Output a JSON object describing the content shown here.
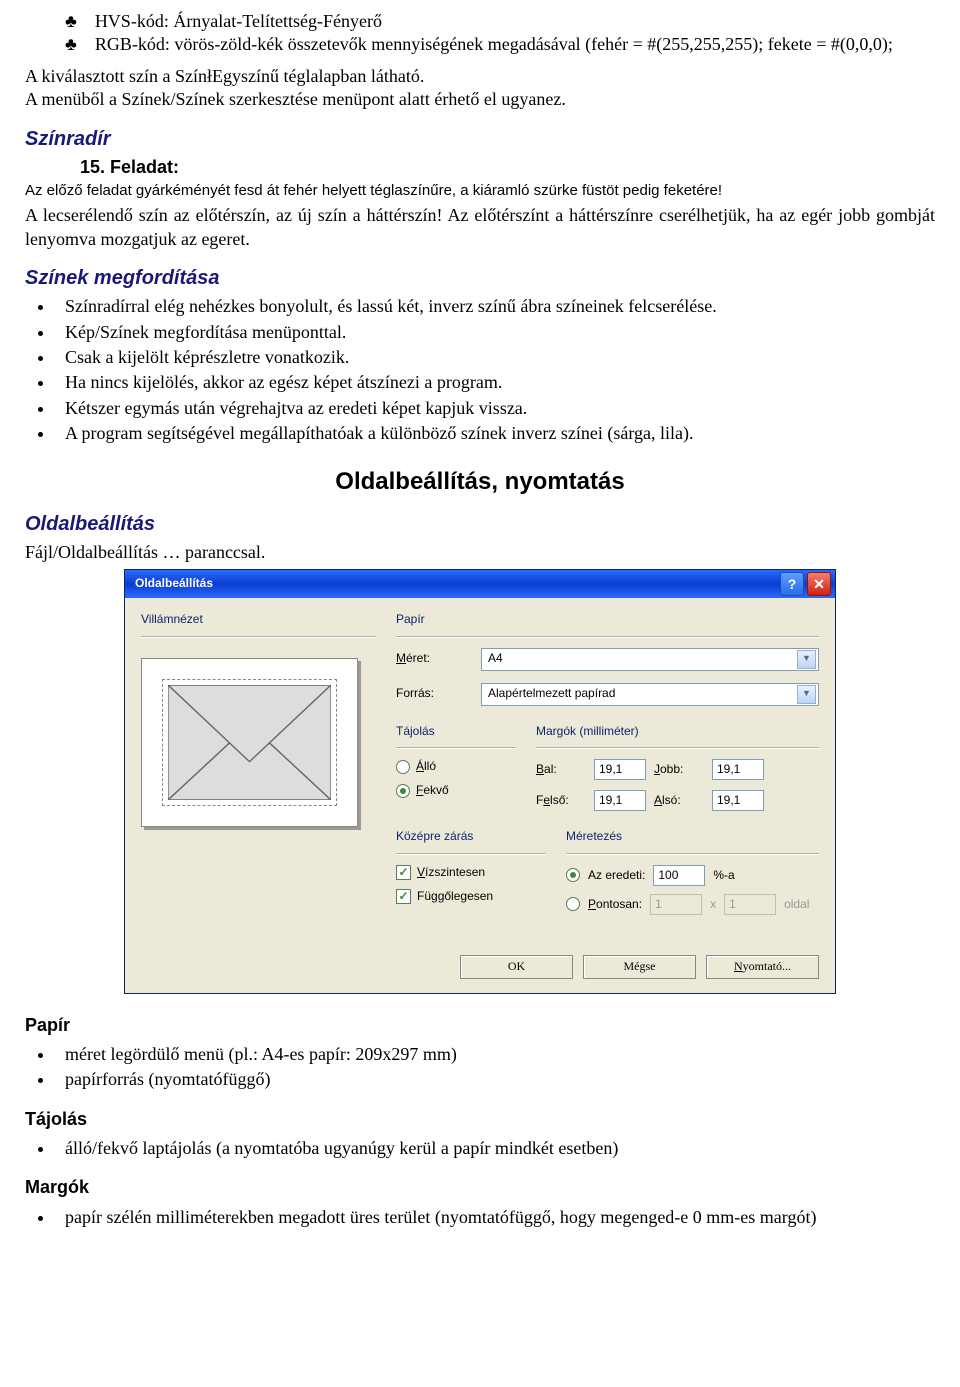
{
  "intro": {
    "hvs": "HVS-kód: Árnyalat-Telítettség-Fényerő",
    "rgb": "RGB-kód: vörös-zöld-kék összetevők mennyiségének megadásával (fehér = #(255,255,255); fekete = #(0,0,0);",
    "chosen": "A kiválasztott szín a SzínłEgyszínű téglalapban látható.",
    "menu": "A menüből a Színek/Színek szerkesztése menüpont alatt érhető el ugyanez."
  },
  "eraser": {
    "title": "Színradír",
    "tasknum": "15. Feladat:",
    "taskbody": "Az előző feladat gyárkéményét fesd át fehér helyett téglaszínűre, a kiáramló szürke füstöt pedig feketére!",
    "note": "A lecserélendő szín az előtérszín, az új szín a háttérszín! Az előtérszínt a háttérszínre cserélhetjük, ha az egér jobb gombját lenyomva mozgatjuk az egeret."
  },
  "invert": {
    "title": "Színek megfordítása",
    "items": [
      "Színradírral elég nehézkes bonyolult, és lassú két, inverz színű ábra színeinek felcserélése.",
      "Kép/Színek megfordítása menüponttal.",
      "Csak a kijelölt képrészletre vonatkozik.",
      "Ha nincs kijelölés, akkor az egész képet átszínezi a program.",
      "Kétszer egymás után végrehajtva az eredeti képet kapjuk vissza.",
      "A program segítségével megállapíthatóak a különböző színek inverz színei (sárga, lila)."
    ]
  },
  "page_setup_heading": "Oldalbeállítás, nyomtatás",
  "setup": {
    "title": "Oldalbeállítás",
    "cmd": "Fájl/Oldalbeállítás … paranccsal."
  },
  "dialog": {
    "title": "Oldalbeállítás",
    "preview_label": "Villámnézet",
    "paper": {
      "label": "Papír",
      "size_label": "Méret:",
      "size_value": "A4",
      "source_label": "Forrás:",
      "source_value": "Alapértelmezett papírad"
    },
    "orientation": {
      "label": "Tájolás",
      "portrait": "Álló",
      "landscape": "Fekvő"
    },
    "margins": {
      "label": "Margók (milliméter)",
      "left_label": "Bal:",
      "left": "19,1",
      "right_label": "Jobb:",
      "right": "19,1",
      "top_label": "Felső:",
      "top": "19,1",
      "bottom_label": "Alsó:",
      "bottom": "19,1"
    },
    "center": {
      "label": "Középre zárás",
      "horiz": "Vízszintesen",
      "vert": "Függőlegesen"
    },
    "scale": {
      "label": "Méretezés",
      "orig": "Az eredeti:",
      "orig_val": "100",
      "orig_suffix": "%-a",
      "exact": "Pontosan:",
      "exact_w": "1",
      "exact_x": "x",
      "exact_h": "1",
      "exact_suffix": "oldal"
    },
    "buttons": {
      "ok": "OK",
      "cancel": "Mégse",
      "print": "Nyomtató..."
    }
  },
  "paper": {
    "title": "Papír",
    "items": [
      "méret legördülő menü (pl.: A4-es papír: 209x297 mm)",
      "papírforrás (nyomtatófüggő)"
    ]
  },
  "orient": {
    "title": "Tájolás",
    "items": [
      "álló/fekvő laptájolás (a nyomtatóba ugyanúgy kerül a papír mindkét esetben)"
    ]
  },
  "margins_doc": {
    "title": "Margók",
    "items": [
      "papír szélén milliméterekben megadott üres terület (nyomtatófüggő, hogy megenged-e 0 mm-es margót)"
    ]
  }
}
